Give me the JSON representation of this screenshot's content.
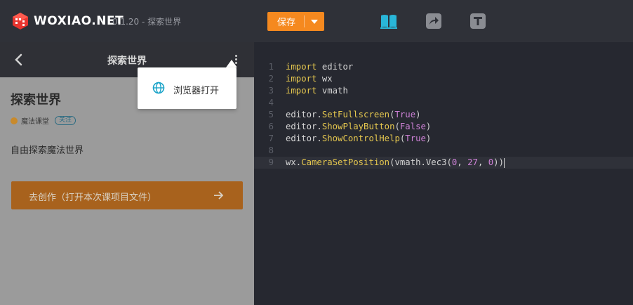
{
  "app": {
    "logo_text": "WOXIAO.NET",
    "version_text": "0.1.20 - 探索世界"
  },
  "toolbar": {
    "save_label": "保存",
    "icons": [
      "book-icon",
      "share-icon",
      "text-icon"
    ]
  },
  "left_panel": {
    "header_title": "探索世界",
    "project_title": "探索世界",
    "author": "魔法课堂",
    "follow_label": "关注",
    "description": "自由探索魔法世界",
    "create_button_label": "去创作（打开本次课项目文件）"
  },
  "popup_menu": {
    "items": [
      {
        "icon": "globe-icon",
        "label": "浏览器打开"
      }
    ]
  },
  "editor": {
    "lines": [
      {
        "n": "1",
        "segments": [
          [
            "kw",
            "import"
          ],
          [
            "t",
            " editor"
          ]
        ]
      },
      {
        "n": "2",
        "segments": [
          [
            "kw",
            "import"
          ],
          [
            "t",
            " wx"
          ]
        ]
      },
      {
        "n": "3",
        "segments": [
          [
            "kw",
            "import"
          ],
          [
            "t",
            " vmath"
          ]
        ]
      },
      {
        "n": "4",
        "segments": []
      },
      {
        "n": "5",
        "segments": [
          [
            "t",
            "editor."
          ],
          [
            "fn",
            "SetFullscreen"
          ],
          [
            "t",
            "("
          ],
          [
            "kwc",
            "True"
          ],
          [
            "t",
            ")"
          ]
        ]
      },
      {
        "n": "6",
        "segments": [
          [
            "t",
            "editor."
          ],
          [
            "fn",
            "ShowPlayButton"
          ],
          [
            "t",
            "("
          ],
          [
            "kwc",
            "False"
          ],
          [
            "t",
            ")"
          ]
        ]
      },
      {
        "n": "7",
        "segments": [
          [
            "t",
            "editor."
          ],
          [
            "fn",
            "ShowControlHelp"
          ],
          [
            "t",
            "("
          ],
          [
            "kwc",
            "True"
          ],
          [
            "t",
            ")"
          ]
        ]
      },
      {
        "n": "8",
        "segments": []
      },
      {
        "n": "9",
        "segments": [
          [
            "t",
            "wx."
          ],
          [
            "fn",
            "CameraSetPosition"
          ],
          [
            "t",
            "(vmath.Vec3("
          ],
          [
            "num",
            "0"
          ],
          [
            "t",
            ", "
          ],
          [
            "num",
            "27"
          ],
          [
            "t",
            ", "
          ],
          [
            "num",
            "0"
          ],
          [
            "t",
            "))"
          ]
        ],
        "active": true
      }
    ]
  },
  "colors": {
    "accent": "#f5891f",
    "topbar": "#2f3138",
    "editor_bg": "#262830",
    "keyword": "#e6c84f",
    "constant": "#cf82d8"
  }
}
